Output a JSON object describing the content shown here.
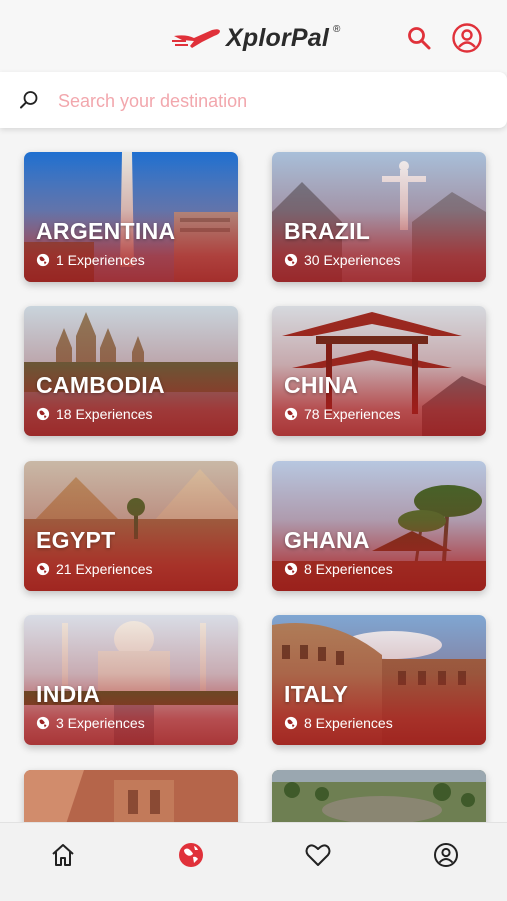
{
  "app": {
    "name": "XplorPal",
    "reg": "®",
    "accent": "#e0313a"
  },
  "header": {
    "search_icon": "search-icon",
    "profile_icon": "user-circle-icon"
  },
  "search": {
    "placeholder": "Search your destination",
    "value": ""
  },
  "destinations": [
    {
      "name": "ARGENTINA",
      "experiences": "1 Experiences"
    },
    {
      "name": "BRAZIL",
      "experiences": "30 Experiences"
    },
    {
      "name": "CAMBODIA",
      "experiences": "18 Experiences"
    },
    {
      "name": "CHINA",
      "experiences": "78 Experiences"
    },
    {
      "name": "EGYPT",
      "experiences": "21 Experiences"
    },
    {
      "name": "GHANA",
      "experiences": "8 Experiences"
    },
    {
      "name": "INDIA",
      "experiences": "3 Experiences"
    },
    {
      "name": "ITALY",
      "experiences": "8 Experiences"
    },
    {
      "name": "",
      "experiences": ""
    },
    {
      "name": "",
      "experiences": ""
    }
  ],
  "bottom_nav": [
    {
      "icon": "home-icon",
      "active": false
    },
    {
      "icon": "globe-icon",
      "active": true
    },
    {
      "icon": "heart-icon",
      "active": false
    },
    {
      "icon": "user-circle-icon",
      "active": false
    }
  ]
}
